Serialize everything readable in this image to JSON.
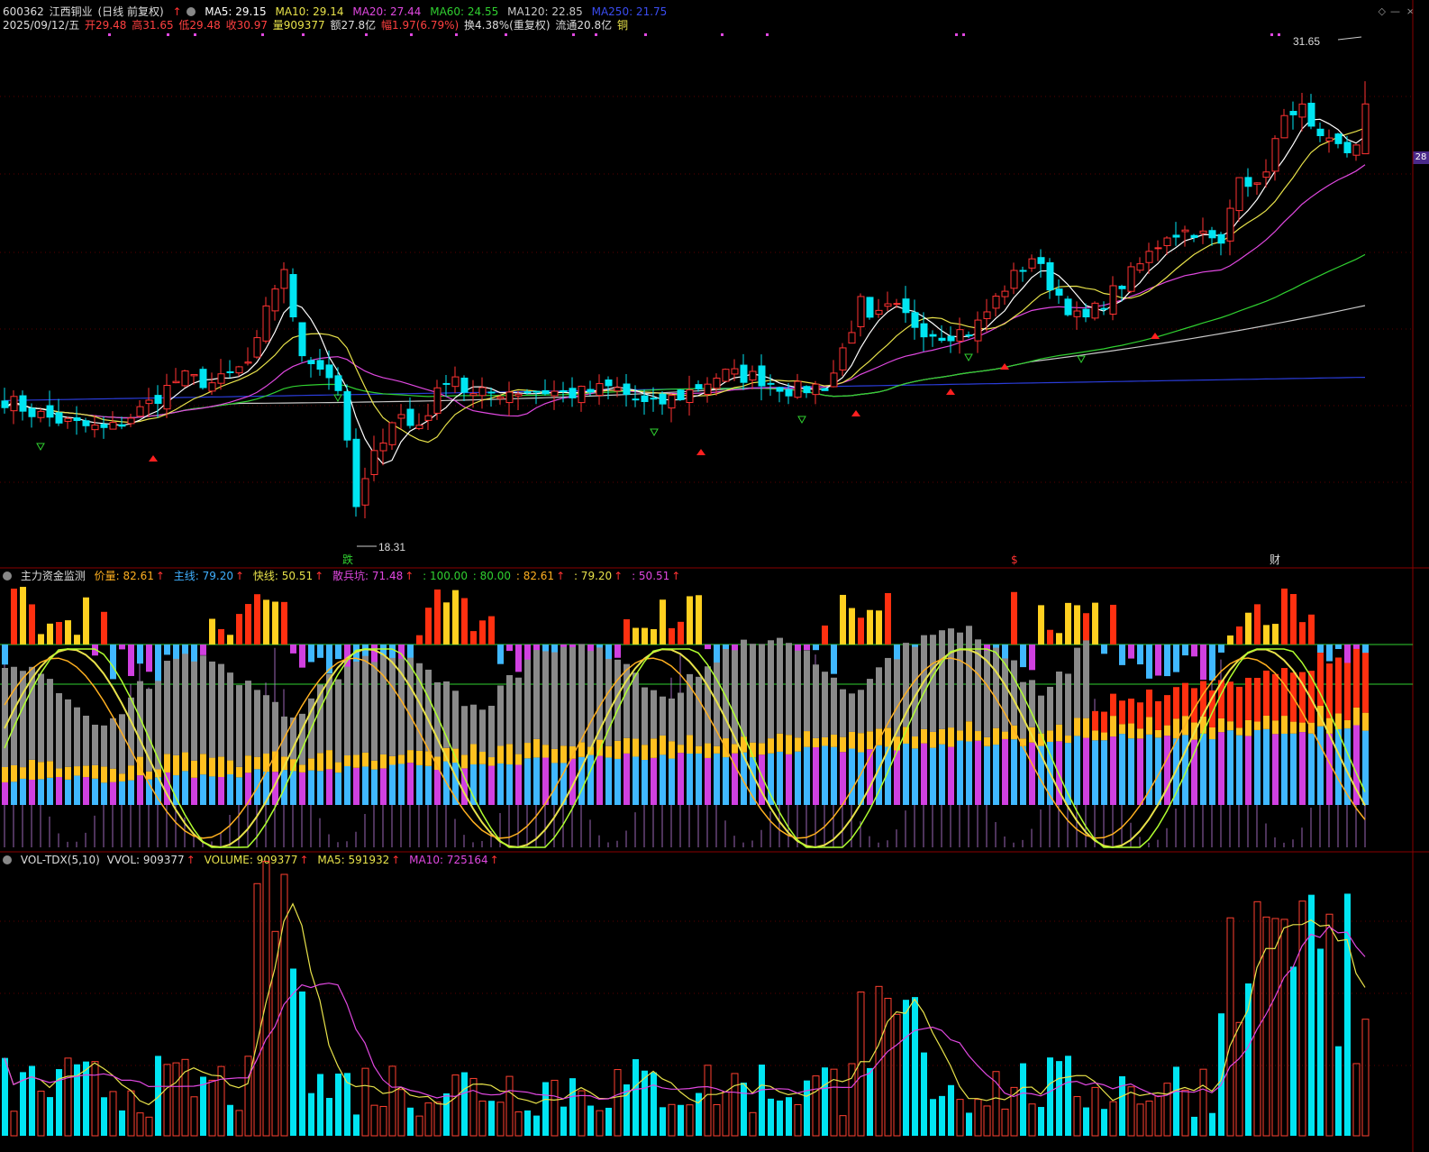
{
  "stock": {
    "code": "600362",
    "name": "江西铜业",
    "mode": "(日线 前复权)",
    "date": "2025/09/12/五",
    "open": "开29.48",
    "high": "高31.65",
    "low": "低29.48",
    "close": "收30.97",
    "vol": "量909377",
    "amount": "额27.8亿",
    "change": "幅1.97(6.79%)",
    "turnover": "换4.38%(重复权)",
    "float": "流通20.8亿",
    "tag": "铜"
  },
  "ma_legend": {
    "ma5": "MA5: 29.15",
    "ma10": "MA10: 29.14",
    "ma20": "MA20: 27.44",
    "ma60": "MA60: 24.55",
    "ma120": "MA120: 22.85",
    "ma250": "MA250: 21.75"
  },
  "price_annotations": {
    "high_label": "31.65",
    "low_label": "18.31",
    "price_axis_tag": "28",
    "marker_1": "跌",
    "marker_2": "$",
    "marker_3": "财"
  },
  "indicator": {
    "name": "主力资金监测",
    "v1": "价量: 82.61",
    "v2": "主线: 79.20",
    "v3": "快线: 50.51",
    "v4": "散兵坑: 71.48",
    "v5": ": 100.00",
    "v6": ": 80.00",
    "v7": ": 82.61",
    "v8": ": 79.20",
    "v9": ": 50.51"
  },
  "volume_legend": {
    "name": "VOL-TDX(5,10)",
    "vvol": "VVOL: 909377",
    "volume": "VOLUME: 909377",
    "ma5": "MA5: 591932",
    "ma10": "MA10: 725164"
  },
  "colors": {
    "up": "#ff3232",
    "down": "#00e5f2",
    "ma5": "#ffffff",
    "ma10": "#e8e24a",
    "ma20": "#e048e0",
    "ma60": "#30d030",
    "ma120": "#c8c8c8",
    "ma250": "#2a3cd8",
    "grid": "#7a0000"
  },
  "chart_data": {
    "type": "candlestick",
    "ylim": [
      17.5,
      33.0
    ],
    "high_close_pairs": [
      {
        "x": 0,
        "o": 22.4,
        "c": 22.2
      },
      {
        "x": 40,
        "o": 22.0,
        "c": 21.7
      },
      {
        "x": 80,
        "o": 21.8,
        "c": 21.4
      },
      {
        "x": 120,
        "o": 21.6,
        "c": 21.2
      },
      {
        "x": 160,
        "o": 21.3,
        "c": 21.9
      },
      {
        "x": 200,
        "o": 22.0,
        "c": 22.8
      },
      {
        "x": 240,
        "o": 23.1,
        "c": 22.6
      },
      {
        "x": 280,
        "o": 22.7,
        "c": 23.3
      },
      {
        "x": 300,
        "o": 24.0,
        "c": 25.2
      },
      {
        "x": 315,
        "o": 25.3,
        "c": 26.1
      },
      {
        "x": 330,
        "o": 24.2,
        "c": 23.6
      },
      {
        "x": 350,
        "o": 23.8,
        "c": 23.3
      },
      {
        "x": 375,
        "o": 23.0,
        "c": 22.5
      },
      {
        "x": 395,
        "o": 19.8,
        "c": 18.9
      },
      {
        "x": 407,
        "o": 18.8,
        "c": 19.8
      },
      {
        "x": 420,
        "o": 20.3,
        "c": 20.8
      },
      {
        "x": 440,
        "o": 21.3,
        "c": 21.8
      },
      {
        "x": 460,
        "o": 21.6,
        "c": 21.2
      },
      {
        "x": 480,
        "o": 21.4,
        "c": 22.0
      },
      {
        "x": 500,
        "o": 22.3,
        "c": 23.1
      },
      {
        "x": 520,
        "o": 22.6,
        "c": 22.2
      },
      {
        "x": 560,
        "o": 22.0,
        "c": 22.4
      },
      {
        "x": 600,
        "o": 22.2,
        "c": 22.4
      },
      {
        "x": 640,
        "o": 22.6,
        "c": 22.3
      },
      {
        "x": 680,
        "o": 22.3,
        "c": 22.5
      },
      {
        "x": 720,
        "o": 22.3,
        "c": 21.9
      },
      {
        "x": 760,
        "o": 21.9,
        "c": 22.3
      },
      {
        "x": 800,
        "o": 22.6,
        "c": 22.9
      },
      {
        "x": 840,
        "o": 23.0,
        "c": 22.8
      },
      {
        "x": 880,
        "o": 23.0,
        "c": 22.4
      },
      {
        "x": 920,
        "o": 22.3,
        "c": 22.6
      },
      {
        "x": 955,
        "o": 23.8,
        "c": 25.0
      },
      {
        "x": 965,
        "o": 25.2,
        "c": 24.4
      },
      {
        "x": 990,
        "o": 24.6,
        "c": 24.9
      },
      {
        "x": 1020,
        "o": 24.6,
        "c": 24.3
      },
      {
        "x": 1040,
        "o": 24.4,
        "c": 24.1
      },
      {
        "x": 1080,
        "o": 24.5,
        "c": 24.2
      },
      {
        "x": 1115,
        "o": 24.5,
        "c": 25.5
      },
      {
        "x": 1145,
        "o": 25.8,
        "c": 26.4
      },
      {
        "x": 1165,
        "o": 26.0,
        "c": 25.6
      },
      {
        "x": 1200,
        "o": 25.0,
        "c": 24.4
      },
      {
        "x": 1230,
        "o": 24.6,
        "c": 25.2
      },
      {
        "x": 1260,
        "o": 25.5,
        "c": 26.0
      },
      {
        "x": 1295,
        "o": 26.4,
        "c": 27.1
      },
      {
        "x": 1325,
        "o": 27.8,
        "c": 27.2
      },
      {
        "x": 1355,
        "o": 27.0,
        "c": 26.7
      },
      {
        "x": 1375,
        "o": 26.8,
        "c": 29.0
      },
      {
        "x": 1395,
        "o": 29.2,
        "c": 28.4
      },
      {
        "x": 1420,
        "o": 28.9,
        "c": 30.2
      },
      {
        "x": 1440,
        "o": 30.4,
        "c": 31.1
      },
      {
        "x": 1460,
        "o": 30.6,
        "c": 29.8
      },
      {
        "x": 1480,
        "o": 30.6,
        "c": 29.7
      },
      {
        "x": 1500,
        "o": 29.7,
        "c": 29.5
      },
      {
        "x": 1520,
        "o": 29.48,
        "c": 30.97
      }
    ]
  }
}
